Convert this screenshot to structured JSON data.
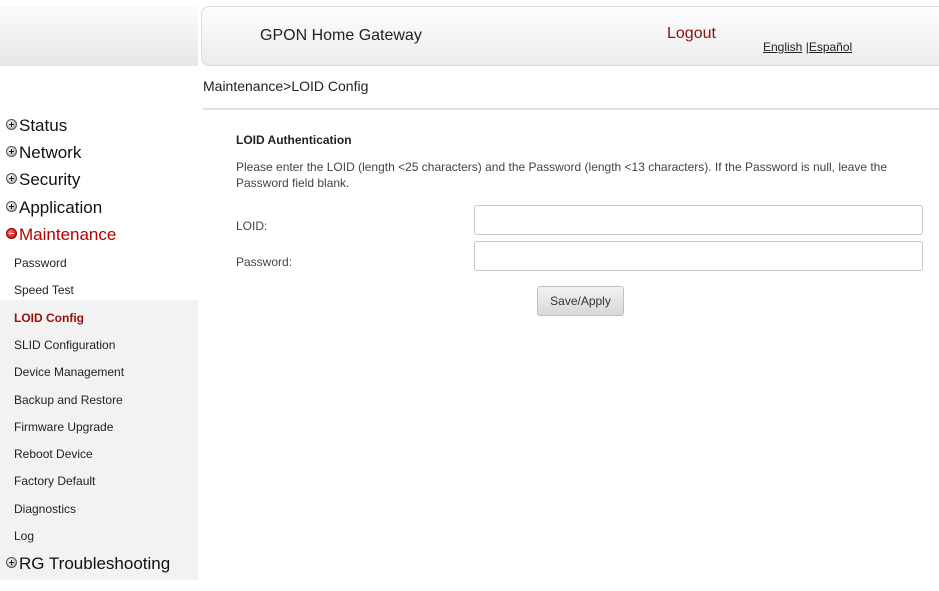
{
  "header": {
    "title": "GPON Home Gateway",
    "logout": "Logout",
    "lang_english": "English",
    "lang_separator": " |",
    "lang_spanish": "Español"
  },
  "breadcrumb": "Maintenance>LOID Config",
  "sidebar": {
    "main_items": [
      {
        "label": "Status",
        "icon": "plus-circle-icon"
      },
      {
        "label": "Network",
        "icon": "plus-circle-icon"
      },
      {
        "label": "Security",
        "icon": "plus-circle-icon"
      },
      {
        "label": "Application",
        "icon": "plus-circle-icon"
      },
      {
        "label": "Maintenance",
        "icon": "minus-circle-icon",
        "expanded": true
      },
      {
        "label": "RG Troubleshooting",
        "icon": "plus-circle-icon"
      }
    ],
    "sub_items": [
      {
        "label": "Password"
      },
      {
        "label": "Speed Test"
      },
      {
        "label": "LOID Config",
        "active": true
      },
      {
        "label": "SLID Configuration"
      },
      {
        "label": "Device Management"
      },
      {
        "label": "Backup and Restore"
      },
      {
        "label": "Firmware Upgrade"
      },
      {
        "label": "Reboot Device"
      },
      {
        "label": "Factory Default"
      },
      {
        "label": "Diagnostics"
      },
      {
        "label": "Log"
      }
    ]
  },
  "content": {
    "section_title": "LOID Authentication",
    "instructions": "Please enter the LOID (length <25 characters) and the Password (length <13 characters). If the Password is null, leave the Password field blank.",
    "loid_label": "LOID:",
    "loid_value": "",
    "password_label": "Password:",
    "password_value": "",
    "save_label": "Save/Apply"
  },
  "colors": {
    "active_menu": "#b80000",
    "active_sub": "#9b0d0d",
    "logout": "#8b0f0f"
  }
}
